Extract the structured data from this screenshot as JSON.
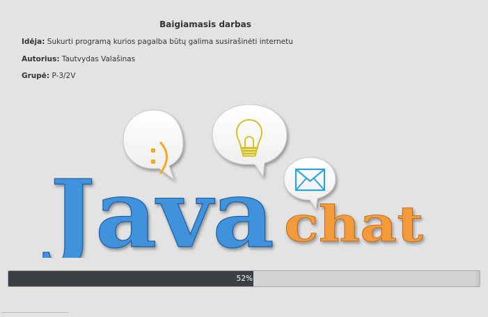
{
  "header": {
    "title": "Baigiamasis darbas"
  },
  "info": {
    "idea_label": "Idėja:",
    "idea_value": "Sukurti programą kurios pagalba būtų galima susirašinėti internetu",
    "author_label": "Autorius:",
    "author_value": "Tautvydas Valašinas",
    "group_label": "Grupė:",
    "group_value": "P-3/2V"
  },
  "logo": {
    "word_java": "Java",
    "word_chat": "chat",
    "java_color": "#3f92dd",
    "chat_color": "#f39a3a",
    "bubble_icons": [
      "smiley-icon",
      "lightbulb-icon",
      "envelope-icon"
    ]
  },
  "progress": {
    "value": 52,
    "label": "52%",
    "fill_color": "#3a3f45"
  },
  "colors": {
    "background": "#e3e3e3",
    "icon_blue": "#2ba3dd",
    "icon_yellow": "#d9c21f"
  }
}
